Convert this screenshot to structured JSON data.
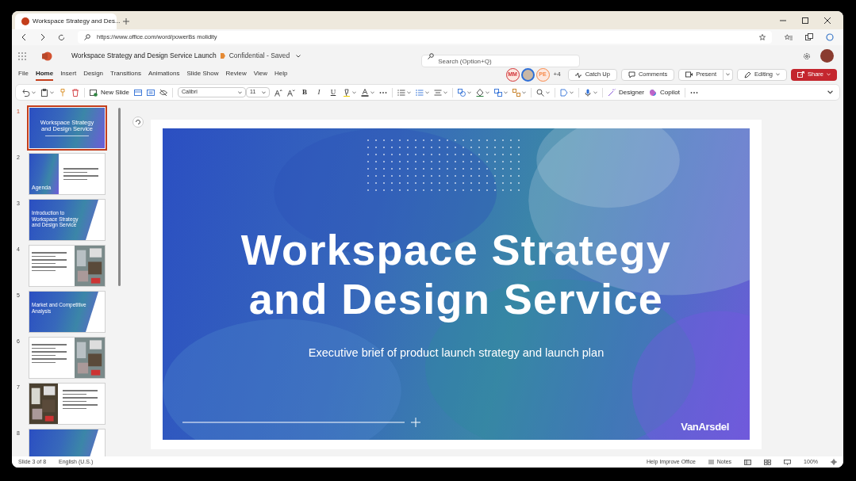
{
  "browser": {
    "tab_title": "Workspace Strategy and Des...",
    "url": "https://www.office.com/word/powerBs molidity"
  },
  "app": {
    "document_title": "Workspace Strategy and Design Service Launch",
    "status": "Confidential - Saved",
    "search_placeholder": "Search (Option+Q)"
  },
  "menu_tabs": [
    {
      "label": "File",
      "selected": false
    },
    {
      "label": "Home",
      "selected": true
    },
    {
      "label": "Insert",
      "selected": false
    },
    {
      "label": "Design",
      "selected": false
    },
    {
      "label": "Transitions",
      "selected": false
    },
    {
      "label": "Animations",
      "selected": false
    },
    {
      "label": "Slide Show",
      "selected": false
    },
    {
      "label": "Review",
      "selected": false
    },
    {
      "label": "View",
      "selected": false
    },
    {
      "label": "Help",
      "selected": false
    }
  ],
  "collaborators": [
    {
      "kind": "initials",
      "initials": "MM",
      "color": "#d13438"
    },
    {
      "kind": "avatar",
      "color": "#2f6fd6"
    },
    {
      "kind": "initials",
      "initials": "PE",
      "color": "#f7894a"
    }
  ],
  "more_collaborators": "+4",
  "actions": [
    {
      "kind": "plain",
      "label": "Catch Up"
    },
    {
      "kind": "plain",
      "label": "Comments"
    },
    {
      "kind": "split",
      "label": "Present"
    },
    {
      "kind": "menu",
      "label": "Editing"
    },
    {
      "kind": "primary",
      "label": "Share"
    }
  ],
  "ribbon": {
    "new_slide": "New Slide",
    "font": "Calibri",
    "font_size": "11",
    "format_buttons": [
      "B",
      "I",
      "U"
    ],
    "designer": "Designer",
    "copilot": "Copilot"
  },
  "slides": [
    {
      "number": "1",
      "kind": "title",
      "selected": true,
      "title": "Workspace Strategy and Design Service"
    },
    {
      "number": "2",
      "kind": "agenda",
      "selected": false,
      "title": "Agenda"
    },
    {
      "number": "3",
      "kind": "section",
      "selected": false,
      "title": "Introduction to Workspace Strategy and Design Service"
    },
    {
      "number": "4",
      "kind": "photo-right",
      "selected": false
    },
    {
      "number": "5",
      "kind": "section",
      "selected": false,
      "title": "Market and Competitive Analysis"
    },
    {
      "number": "6",
      "kind": "photo-right",
      "selected": false
    },
    {
      "number": "7",
      "kind": "photo-left",
      "selected": false
    },
    {
      "number": "8",
      "kind": "section",
      "selected": false
    }
  ],
  "slide": {
    "title_lines": [
      "Workspace Strategy",
      "and Design Service"
    ],
    "subtitle": "Executive brief of product launch strategy and launch plan",
    "logo": "VanArsdel"
  },
  "status_bar": {
    "slide_position": "Slide 3 of 8",
    "language": "English (U.S.)",
    "feedback": "Help Improve Office",
    "notes": "Notes",
    "zoom": "100%"
  }
}
